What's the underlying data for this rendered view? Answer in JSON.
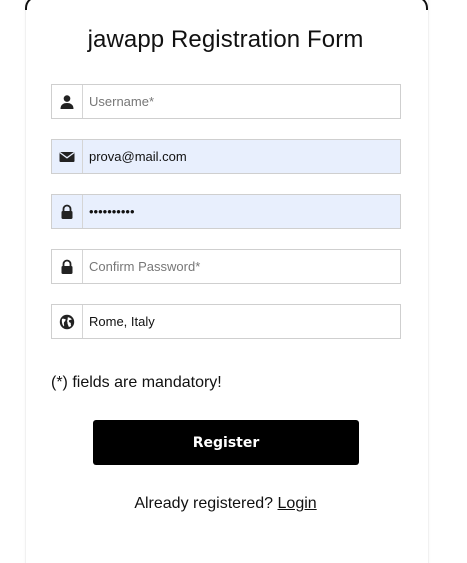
{
  "form": {
    "title": "jawapp Registration Form",
    "fields": {
      "username": {
        "placeholder": "Username*",
        "value": "",
        "icon": "user-icon"
      },
      "email": {
        "placeholder": "",
        "value": "prova@mail.com",
        "icon": "envelope-icon"
      },
      "password": {
        "placeholder": "",
        "value": "••••••••••",
        "icon": "lock-icon"
      },
      "confirm_password": {
        "placeholder": "Confirm Password*",
        "value": "",
        "icon": "lock-icon"
      },
      "location": {
        "placeholder": "",
        "value": "Rome, Italy",
        "icon": "globe-icon"
      }
    },
    "mandatory_note": "(*) fields are mandatory!",
    "register_label": "Register",
    "login_prompt": "Already registered?",
    "login_link": "Login"
  },
  "colors": {
    "filled_field_bg": "#e8effd",
    "button_bg": "#000000",
    "button_text": "#ffffff",
    "border": "#cfcfcf"
  }
}
